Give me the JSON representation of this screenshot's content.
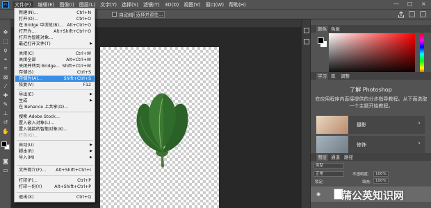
{
  "menubar": {
    "logo": "Ps",
    "items": [
      "文件(F)",
      "编辑(E)",
      "图像(I)",
      "图层(L)",
      "文字(Y)",
      "选择(S)",
      "滤镜(T)",
      "3D(D)",
      "视图(V)",
      "窗口(W)",
      "帮助(H)"
    ],
    "window_controls": [
      "—",
      "□",
      "×"
    ]
  },
  "options": {
    "checkbox_label": "自动增强",
    "button_label": "选择并遮住..."
  },
  "file_menu": [
    {
      "label": "新建(N)...",
      "shortcut": "Ctrl+N"
    },
    {
      "label": "打开(O)...",
      "shortcut": "Ctrl+O"
    },
    {
      "label": "在 Bridge 中浏览(B)...",
      "shortcut": "Alt+Ctrl+O"
    },
    {
      "label": "打开为...",
      "shortcut": "Alt+Shift+Ctrl+O"
    },
    {
      "label": "打开为智能对象...",
      "shortcut": ""
    },
    {
      "label": "最近打开文件(T)",
      "shortcut": "",
      "submenu": true
    },
    {
      "label": "关闭(C)",
      "shortcut": "Ctrl+W"
    },
    {
      "label": "关闭全部",
      "shortcut": "Alt+Ctrl+W"
    },
    {
      "label": "关闭并转到 Bridge...",
      "shortcut": "Shift+Ctrl+W"
    },
    {
      "label": "存储(S)",
      "shortcut": "Ctrl+S"
    },
    {
      "label": "存储为(A)...",
      "shortcut": "Shift+Ctrl+S",
      "highlighted": true
    },
    {
      "label": "恢复(V)",
      "shortcut": "F12"
    },
    {
      "label": "导出(E)",
      "shortcut": "",
      "submenu": true
    },
    {
      "label": "生成",
      "shortcut": "",
      "submenu": true
    },
    {
      "label": "在 Behance 上共享(D)...",
      "shortcut": ""
    },
    {
      "label": "搜索 Adobe Stock...",
      "shortcut": ""
    },
    {
      "label": "置入嵌入对象(L)...",
      "shortcut": ""
    },
    {
      "label": "置入链接的智能对象(K)...",
      "shortcut": ""
    },
    {
      "label": "打包(G)...",
      "shortcut": "",
      "disabled": true
    },
    {
      "label": "自动(U)",
      "shortcut": "",
      "submenu": true
    },
    {
      "label": "脚本(R)",
      "shortcut": "",
      "submenu": true
    },
    {
      "label": "导入(M)",
      "shortcut": "",
      "submenu": true
    },
    {
      "label": "文件简介(F)...",
      "shortcut": "Alt+Shift+Ctrl+I"
    },
    {
      "label": "打印(P)...",
      "shortcut": "Ctrl+P"
    },
    {
      "label": "打印一份(Y)",
      "shortcut": "Alt+Shift+Ctrl+P"
    },
    {
      "label": "退出(X)",
      "shortcut": "Ctrl+Q"
    }
  ],
  "panels": {
    "color_tabs": [
      "颜色",
      "色板"
    ],
    "learn_tabs": [
      "学习",
      "库",
      "调整"
    ],
    "learn_title": "了解 Photoshop",
    "learn_desc": "在应用程序内直接提供的分步指导教程。从下面选取一个主题开始教程。",
    "cards": [
      {
        "title": "摄影",
        "thumb_color": "#c7a88a"
      },
      {
        "title": "修饰",
        "thumb_color": "#8c9aa6"
      }
    ],
    "layers_tabs": [
      "图层",
      "通道",
      "路径"
    ],
    "layers_kind": "类型",
    "blend_mode": "正常",
    "opacity_label": "不透明度:",
    "opacity_value": "100%",
    "lock_label": "锁定:",
    "fill_label": "填充:",
    "fill_value": "100%"
  },
  "watermark": "蒲公英知识网",
  "colors": {
    "leaf": "#2f6b2a",
    "highlight": "#3a8ee6"
  }
}
